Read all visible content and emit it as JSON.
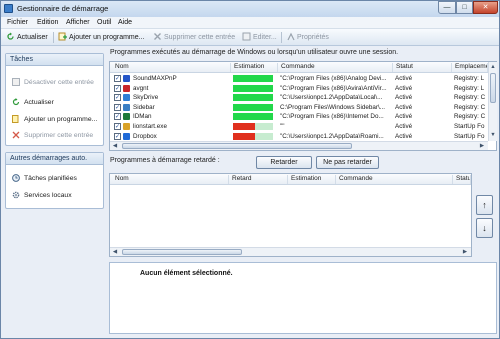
{
  "window": {
    "title": "Gestionnaire de démarrage",
    "min_label": "—",
    "max_label": "□",
    "close_label": "✕"
  },
  "menu": [
    "Fichier",
    "Edition",
    "Afficher",
    "Outil",
    "Aide"
  ],
  "toolbar": {
    "refresh": "Actualiser",
    "add": "Ajouter un programme...",
    "delete": "Supprimer cette entrée",
    "edit": "Editer...",
    "properties": "Propriétés"
  },
  "tasks_panel": {
    "header": "Tâches",
    "items": [
      {
        "label": "Désactiver cette entrée",
        "enabled": false,
        "icon": "disable-icon"
      },
      {
        "label": "Actualiser",
        "enabled": true,
        "icon": "refresh-icon"
      },
      {
        "label": "Ajouter un programme...",
        "enabled": true,
        "icon": "add-program-icon"
      },
      {
        "label": "Supprimer cette entrée",
        "enabled": false,
        "icon": "delete-icon"
      }
    ]
  },
  "other_panel": {
    "header": "Autres démarrages auto.",
    "items": [
      {
        "label": "Tâches planifiées",
        "icon": "clock-icon"
      },
      {
        "label": "Services locaux",
        "icon": "services-icon"
      }
    ]
  },
  "startup": {
    "caption": "Programmes exécutés au démarrage de Windows ou lorsqu'un utilisateur ouvre une session.",
    "columns": [
      "Nom",
      "Estimation",
      "Commande",
      "Statut",
      "Emplacement"
    ],
    "rows": [
      {
        "name": "SoundMAXPnP",
        "estimation": 1.0,
        "command": "\"C:\\Program Files (x86)\\Analog Devi...",
        "status": "Activé",
        "location": "Registry: L",
        "icon_color": "#2456c8"
      },
      {
        "name": "avgnt",
        "estimation": 1.0,
        "command": "\"C:\\Program Files (x86)\\Avira\\AntiVir...",
        "status": "Activé",
        "location": "Registry: L",
        "icon_color": "#c8262a"
      },
      {
        "name": "SkyDrive",
        "estimation": 1.0,
        "command": "\"C:\\Users\\ionpc1.2\\AppData\\Local\\...",
        "status": "Activé",
        "location": "Registry: C",
        "icon_color": "#2f7fd6"
      },
      {
        "name": "Sidebar",
        "estimation": 1.0,
        "command": "C:\\Program Files\\Windows Sidebar\\...",
        "status": "Activé",
        "location": "Registry: C",
        "icon_color": "#3b7fc4"
      },
      {
        "name": "IDMan",
        "estimation": 1.0,
        "command": "\"C:\\Program Files (x86)\\Internet Do...",
        "status": "Activé",
        "location": "Registry: C",
        "icon_color": "#1e7a3a"
      },
      {
        "name": "lionstart.exe",
        "estimation": 0.55,
        "command": "\"\"",
        "status": "Activé",
        "location": "StartUp Fo",
        "icon_color": "#d9a227"
      },
      {
        "name": "Dropbox",
        "estimation": 0.55,
        "command": "\"C:\\Users\\ionpc1.2\\AppData\\Roami...",
        "status": "Activé",
        "location": "StartUp Fo",
        "icon_color": "#1f6ad8"
      }
    ]
  },
  "delayed": {
    "caption": "Programmes à démarrage retardé :",
    "delay_button": "Retarder",
    "nodelay_button": "Ne pas retarder",
    "columns": [
      "Nom",
      "Retard",
      "Estimation",
      "Commande",
      "Statut"
    ],
    "up_label": "↑",
    "down_label": "↓"
  },
  "detail": {
    "text": "Aucun élément sélectionné."
  },
  "colors": {
    "bar_green": "#22d84a",
    "bar_red": "#e0301e",
    "bar_track": "#c7ecd0"
  }
}
